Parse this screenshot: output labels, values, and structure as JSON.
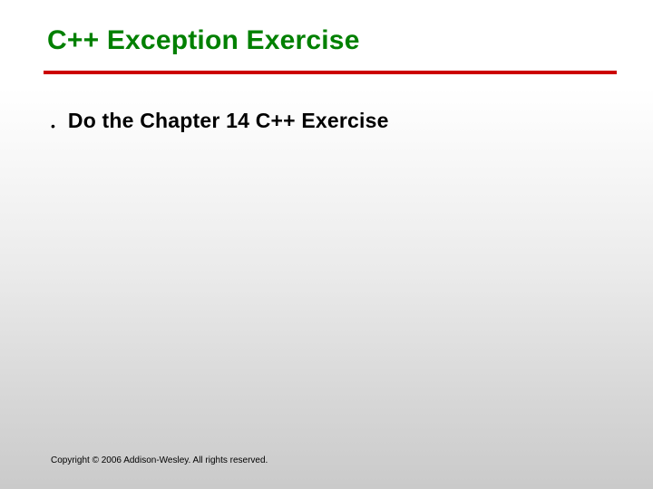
{
  "title": "C++ Exception Exercise",
  "bullets": [
    {
      "text": "Do the Chapter 14 C++ Exercise"
    }
  ],
  "footer": "Copyright © 2006 Addison-Wesley. All rights reserved."
}
